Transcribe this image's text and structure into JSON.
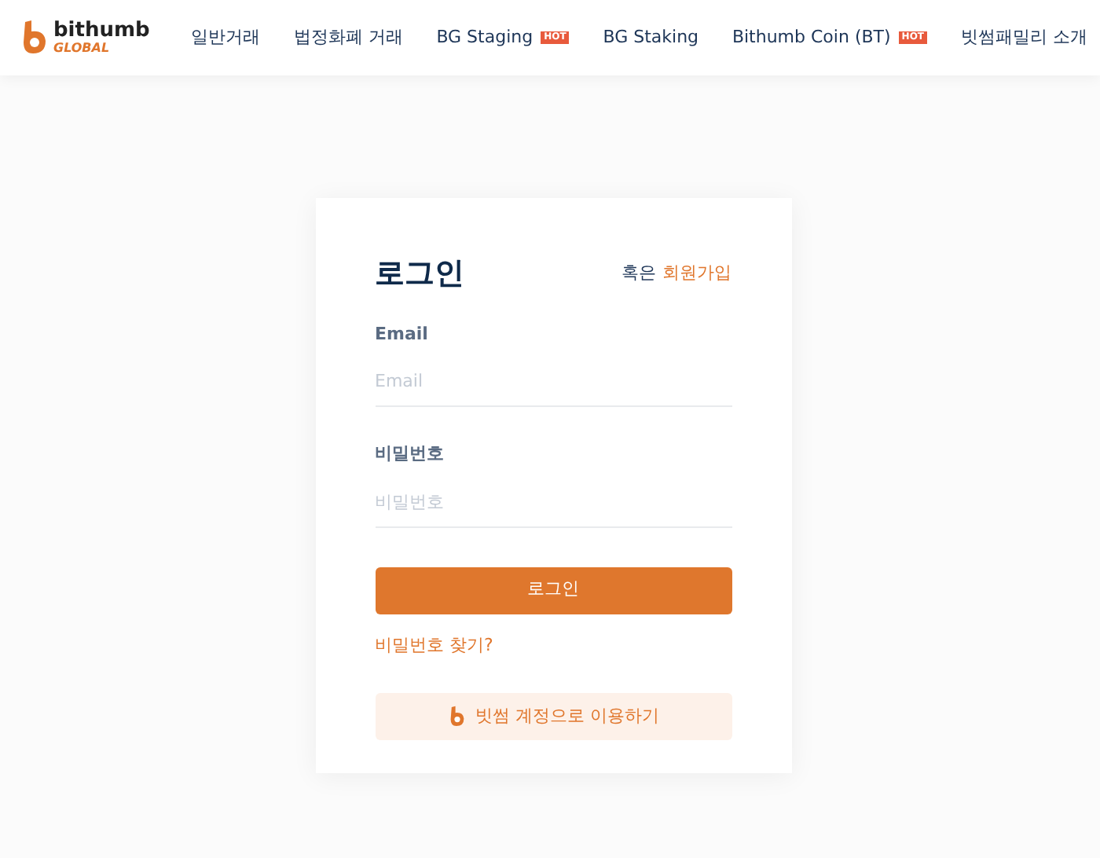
{
  "logo": {
    "name": "bithumb",
    "tagline": "GLOBAL"
  },
  "nav": [
    {
      "label": "일반거래",
      "hot": false
    },
    {
      "label": "법정화폐 거래",
      "hot": false
    },
    {
      "label": "BG Staging",
      "hot": true,
      "badge": "HOT"
    },
    {
      "label": "BG Staking",
      "hot": false
    },
    {
      "label": "Bithumb Coin (BT)",
      "hot": true,
      "badge": "HOT"
    },
    {
      "label": "빗썸패밀리 소개",
      "hot": false
    }
  ],
  "login": {
    "title": "로그인",
    "signup_prefix": "혹은",
    "signup_link": "회원가입",
    "fields": [
      {
        "label": "Email",
        "placeholder": "Email"
      },
      {
        "label": "비밀번호",
        "placeholder": "비밀번호"
      }
    ],
    "submit": "로그인",
    "forgot": "비밀번호 찾기?",
    "bithumb_account": "빗썸 계정으로 이용하기"
  }
}
